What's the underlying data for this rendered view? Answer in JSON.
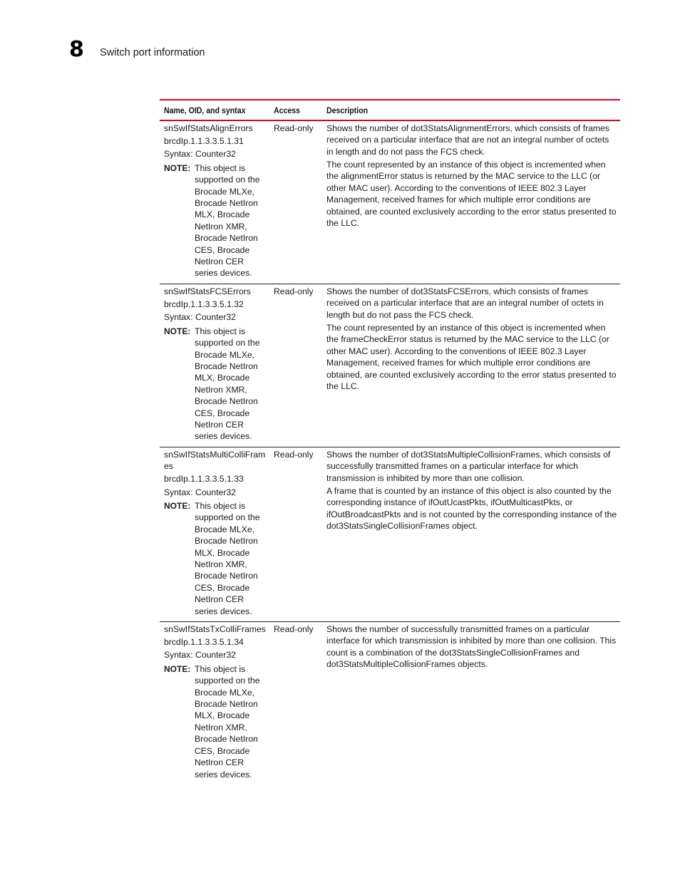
{
  "header": {
    "chapter_number": "8",
    "chapter_title": "Switch port information"
  },
  "table": {
    "columns": [
      "Name, OID, and syntax",
      "Access",
      "Description"
    ],
    "rows": [
      {
        "name": "snSwIfStatsAlignErrors",
        "oid": "brcdIp.1.1.3.3.5.1.31",
        "syntax": "Syntax: Counter32",
        "note_label": "NOTE:",
        "note": "This object is supported on the Brocade MLXe, Brocade NetIron MLX, Brocade NetIron XMR, Brocade NetIron CES, Brocade NetIron CER series devices.",
        "access": "Read-only",
        "description": [
          "Shows the number of dot3StatsAlignmentErrors, which consists of frames received on a particular interface that are not an integral number of octets in length and do not pass the FCS check.",
          "The count represented by an instance of this object is incremented when the alignmentError status is returned by the MAC service to the LLC (or other MAC user). According to the conventions of IEEE 802.3 Layer Management, received frames for which multiple error conditions are obtained, are counted exclusively according to the error status presented to the LLC."
        ]
      },
      {
        "name": "snSwIfStatsFCSErrors",
        "oid": "brcdIp.1.1.3.3.5.1.32",
        "syntax": "Syntax: Counter32",
        "note_label": "NOTE:",
        "note": "This object is supported on the Brocade MLXe, Brocade NetIron MLX, Brocade NetIron XMR, Brocade NetIron CES, Brocade NetIron CER series devices.",
        "access": "Read-only",
        "description": [
          "Shows the number of dot3StatsFCSErrors, which consists of frames received on a particular interface that are an integral number of octets in length but do not pass the FCS check.",
          "The count represented by an instance of this object is incremented when the frameCheckError status is returned by the MAC service to the LLC (or other MAC user). According to the conventions of IEEE 802.3 Layer Management, received frames for which multiple error conditions are obtained, are counted exclusively according to the error status presented to the LLC."
        ]
      },
      {
        "name": "snSwIfStatsMultiColliFrames",
        "oid": "brcdIp.1.1.3.3.5.1.33",
        "syntax": "Syntax: Counter32",
        "note_label": "NOTE:",
        "note": "This object is supported on the Brocade MLXe, Brocade NetIron MLX, Brocade NetIron XMR, Brocade NetIron CES, Brocade NetIron CER series devices.",
        "access": "Read-only",
        "description": [
          "Shows the number of dot3StatsMultipleCollisionFrames, which consists of successfully transmitted frames on a particular interface for which transmission is inhibited by more than one collision.",
          "A frame that is counted by an instance of this object is also counted by the corresponding instance of ifOutUcastPkts, ifOutMulticastPkts, or ifOutBroadcastPkts and is not counted by the corresponding instance of the dot3StatsSingleCollisionFrames object."
        ]
      },
      {
        "name": "snSwIfStatsTxColliFrames",
        "oid": "brcdIp.1.1.3.3.5.1.34",
        "syntax": "Syntax: Counter32",
        "note_label": "NOTE:",
        "note": "This object is supported on the Brocade MLXe, Brocade NetIron MLX, Brocade NetIron XMR, Brocade NetIron CES, Brocade NetIron CER series devices.",
        "access": "Read-only",
        "description": [
          "Shows the number of successfully transmitted frames on a particular interface for which transmission is inhibited by more than one collision. This count is a combination of the dot3StatsSingleCollisionFrames and dot3StatsMultipleCollisionFrames objects."
        ]
      }
    ]
  },
  "colors": {
    "rule_accent": "#e3001b",
    "text": "#1a1a1a"
  }
}
